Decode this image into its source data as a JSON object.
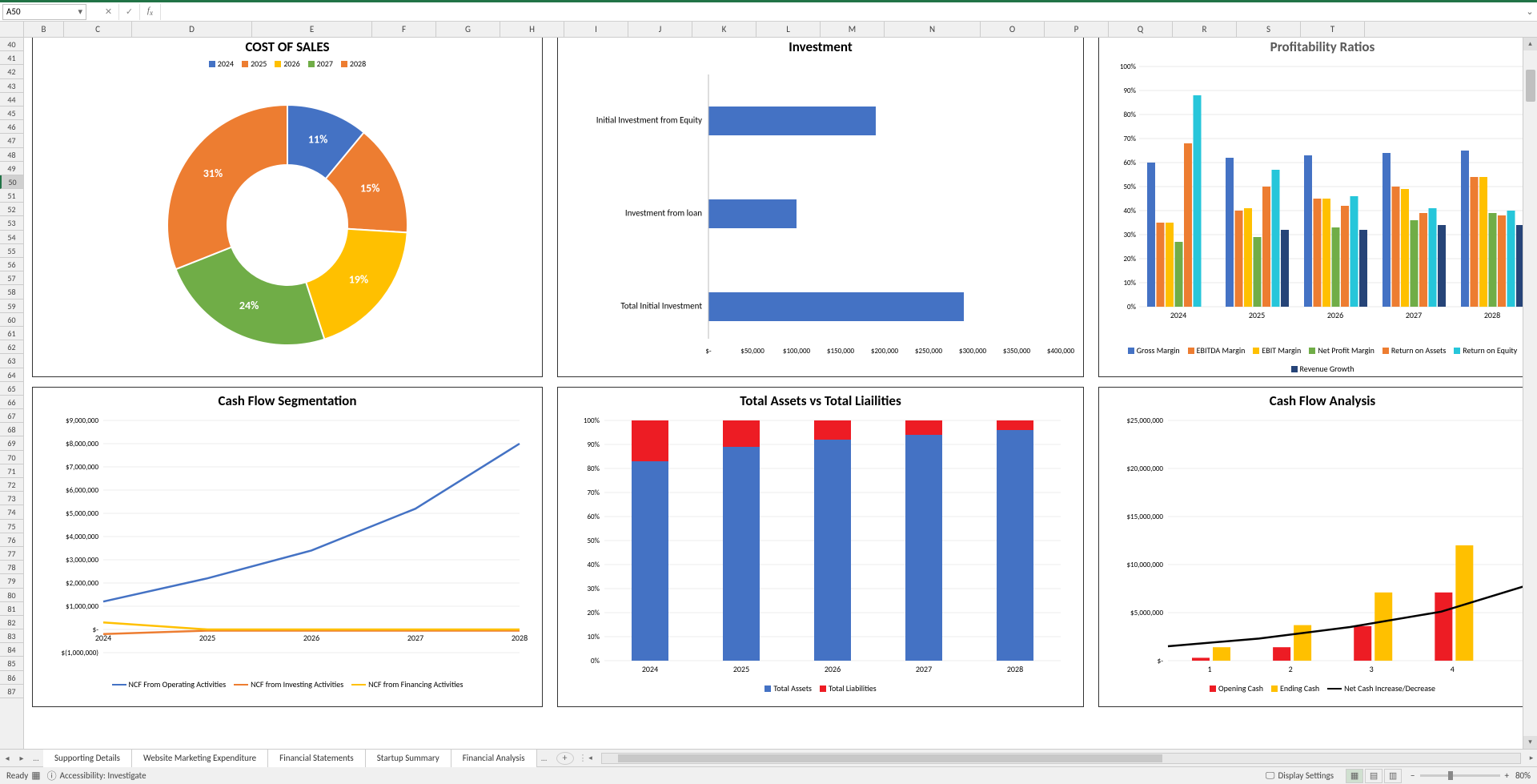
{
  "namebox": "A50",
  "sheet_tabs": [
    "Supporting Details",
    "Website Marketing Expenditure",
    "Financial Statements",
    "Startup Summary",
    "Financial Analysis"
  ],
  "status": {
    "ready": "Ready",
    "accessibility": "Accessibility: Investigate",
    "display": "Display Settings",
    "zoom": "80%"
  },
  "row_start": 40,
  "row_end": 87,
  "columns": [
    "B",
    "C",
    "D",
    "E",
    "F",
    "G",
    "H",
    "I",
    "J",
    "K",
    "L",
    "M",
    "N",
    "O",
    "P",
    "Q",
    "R",
    "S",
    "T"
  ],
  "chart_data": [
    {
      "id": "cost_of_sales",
      "type": "donut",
      "title": "COST OF SALES",
      "legend_years": [
        "2024",
        "2025",
        "2026",
        "2027",
        "2028"
      ],
      "slices": [
        {
          "label": "2024",
          "value": 11,
          "color": "#4472C4"
        },
        {
          "label": "2025",
          "value": 15,
          "color": "#ED7D31"
        },
        {
          "label": "2026",
          "value": 19,
          "color": "#FFC000"
        },
        {
          "label": "2027",
          "value": 24,
          "color": "#70AD47"
        },
        {
          "label": "2028",
          "value": 31,
          "color": "#ED7D31"
        }
      ]
    },
    {
      "id": "investment",
      "type": "bar_h",
      "title": "Investment",
      "categories": [
        "Initial Investment from Equity",
        "Investment from loan",
        "Total Initial Investment"
      ],
      "values": [
        190000,
        100000,
        290000
      ],
      "xticks": [
        "$-",
        "$50,000",
        "$100,000",
        "$150,000",
        "$200,000",
        "$250,000",
        "$300,000",
        "$350,000",
        "$400,000"
      ],
      "color": "#4472C4"
    },
    {
      "id": "profitability",
      "type": "bar_grouped",
      "title": "Profitability Ratios",
      "categories": [
        "2024",
        "2025",
        "2026",
        "2027",
        "2028"
      ],
      "yticks": [
        "0%",
        "10%",
        "20%",
        "30%",
        "40%",
        "50%",
        "60%",
        "70%",
        "80%",
        "90%",
        "100%"
      ],
      "series": [
        {
          "name": "Gross Margin",
          "color": "#4472C4",
          "values": [
            60,
            62,
            63,
            64,
            65
          ]
        },
        {
          "name": "EBITDA Margin",
          "color": "#ED7D31",
          "values": [
            35,
            40,
            45,
            50,
            54
          ]
        },
        {
          "name": "EBIT Margin",
          "color": "#FFC000",
          "values": [
            35,
            41,
            45,
            49,
            54
          ]
        },
        {
          "name": "Net Profit Margin",
          "color": "#70AD47",
          "values": [
            27,
            29,
            33,
            36,
            39
          ]
        },
        {
          "name": "Return on Assets",
          "color": "#ED7D31",
          "values": [
            68,
            50,
            42,
            39,
            38
          ]
        },
        {
          "name": "Return on Equity",
          "color": "#26C6DA",
          "values": [
            88,
            57,
            46,
            41,
            40
          ]
        },
        {
          "name": "Revenue Growth",
          "color": "#264478",
          "values": [
            0,
            32,
            32,
            34,
            34
          ]
        }
      ]
    },
    {
      "id": "cash_flow_seg",
      "type": "line",
      "title": "Cash Flow Segmentation",
      "categories": [
        "2024",
        "2025",
        "2026",
        "2027",
        "2028"
      ],
      "yticks": [
        "$(1,000,000)",
        "$-",
        "$1,000,000",
        "$2,000,000",
        "$3,000,000",
        "$4,000,000",
        "$5,000,000",
        "$6,000,000",
        "$7,000,000",
        "$8,000,000",
        "$9,000,000"
      ],
      "series": [
        {
          "name": "NCF From Operating Activities",
          "color": "#4472C4",
          "values": [
            1200000,
            2200000,
            3400000,
            5200000,
            8000000
          ]
        },
        {
          "name": "NCF from Investing Activities",
          "color": "#ED7D31",
          "values": [
            -200000,
            -50000,
            -50000,
            -50000,
            -50000
          ]
        },
        {
          "name": "NCF from Financing Activities",
          "color": "#FFC000",
          "values": [
            300000,
            0,
            0,
            0,
            0
          ]
        }
      ]
    },
    {
      "id": "assets_liabilities",
      "type": "stacked_bar_pct",
      "title": "Total Assets vs Total Liailities",
      "categories": [
        "2024",
        "2025",
        "2026",
        "2027",
        "2028"
      ],
      "yticks": [
        "0%",
        "10%",
        "20%",
        "30%",
        "40%",
        "50%",
        "60%",
        "70%",
        "80%",
        "90%",
        "100%"
      ],
      "series": [
        {
          "name": "Total Assets",
          "color": "#4472C4",
          "values": [
            83,
            89,
            92,
            94,
            96
          ]
        },
        {
          "name": "Total Liabilities",
          "color": "#ED1C24",
          "values": [
            17,
            11,
            8,
            6,
            4
          ]
        }
      ]
    },
    {
      "id": "cash_flow_analysis",
      "type": "combo",
      "title": "Cash Flow Analysis",
      "categories": [
        "1",
        "2",
        "3",
        "4"
      ],
      "yticks": [
        "$-",
        "$5,000,000",
        "$10,000,000",
        "$15,000,000",
        "$20,000,000",
        "$25,000,000"
      ],
      "bar_series": [
        {
          "name": "Opening Cash",
          "color": "#ED1C24",
          "values": [
            300000,
            1400000,
            3600000,
            7100000
          ]
        },
        {
          "name": "Ending Cash",
          "color": "#FFC000",
          "values": [
            1400000,
            3700000,
            7100000,
            12000000
          ]
        }
      ],
      "line_series": {
        "name": "Net Cash Increase/Decrease",
        "color": "#000",
        "values": [
          1500000,
          2300000,
          3500000,
          5100000,
          8000000
        ]
      }
    }
  ]
}
